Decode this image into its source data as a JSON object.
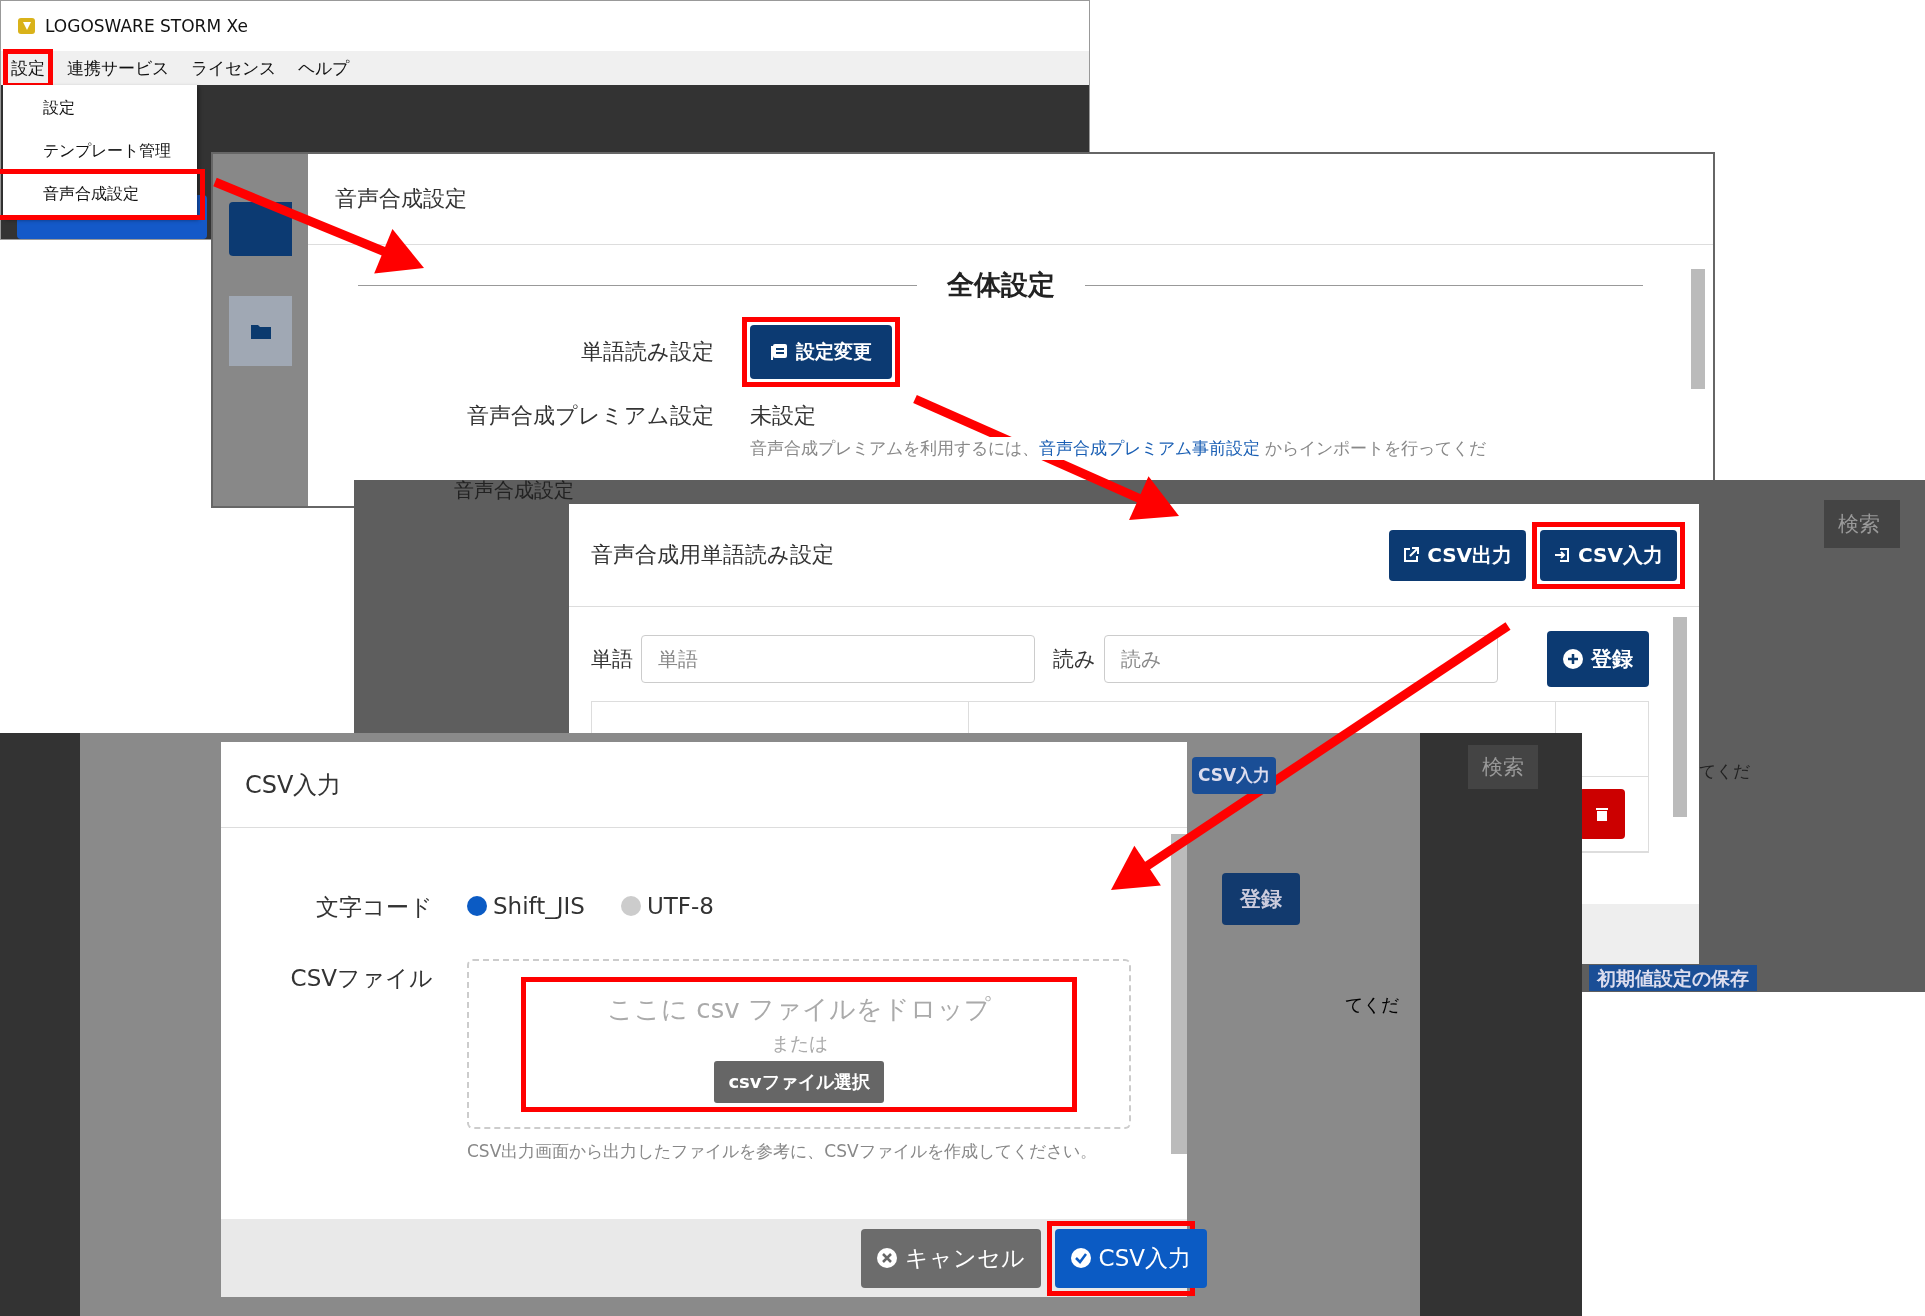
{
  "app_window": {
    "title": "LOGOSWARE STORM Xe",
    "menu": [
      {
        "label": "設定",
        "highlighted": true
      },
      {
        "label": "連携サービス",
        "highlighted": false
      },
      {
        "label": "ライセンス",
        "highlighted": false
      },
      {
        "label": "ヘルプ",
        "highlighted": false
      }
    ],
    "dropdown": [
      {
        "label": "設定",
        "highlighted": false
      },
      {
        "label": "テンプレート管理",
        "highlighted": false
      },
      {
        "label": "音声合成設定",
        "highlighted": true
      }
    ]
  },
  "settings_dialog": {
    "title": "音声合成設定",
    "section": "全体設定",
    "rows": [
      {
        "label": "単語読み設定",
        "kind": "button",
        "value": "設定変更",
        "highlighted": true
      },
      {
        "label": "音声合成プレミアム設定",
        "kind": "text",
        "value": "未設定",
        "highlighted": false
      }
    ],
    "note": {
      "before": "音声合成プレミアムを利用するには、",
      "link": "音声合成プレミアム事前設定",
      "after": " からインポートを行ってくだ"
    }
  },
  "word_dialog": {
    "background": {
      "title": "音声合成設定",
      "search": "検索",
      "note": "てくだ",
      "save": "初期値設定の保存"
    },
    "title": "音声合成用単語読み設定",
    "actions": [
      {
        "label": "CSV出力",
        "kind": "export",
        "highlighted": false
      },
      {
        "label": "CSV入力",
        "kind": "import",
        "highlighted": true
      }
    ],
    "word": {
      "label": "単語",
      "placeholder": "単語"
    },
    "reading": {
      "label": "読み",
      "placeholder": "読み"
    },
    "register": "登録"
  },
  "csv_dialog": {
    "background": {
      "import": "CSV入力",
      "register": "登録",
      "search": "検索",
      "note": "てくだ"
    },
    "title": "CSV入力",
    "encoding": {
      "label": "文字コード",
      "options": [
        {
          "label": "Shift_JIS",
          "selected": true
        },
        {
          "label": "UTF-8",
          "selected": false
        }
      ]
    },
    "file": {
      "label": "CSVファイル",
      "drop_text": "ここに csv ファイルをドロップ",
      "or": "または",
      "choose": "csvファイル選択",
      "highlighted": true,
      "help": "CSV出力画面から出力したファイルを参考に、CSVファイルを作成してください。"
    },
    "buttons": [
      {
        "label": "キャンセル",
        "kind": "cancel",
        "highlighted": false
      },
      {
        "label": "CSV入力",
        "kind": "submit",
        "highlighted": true
      }
    ]
  }
}
